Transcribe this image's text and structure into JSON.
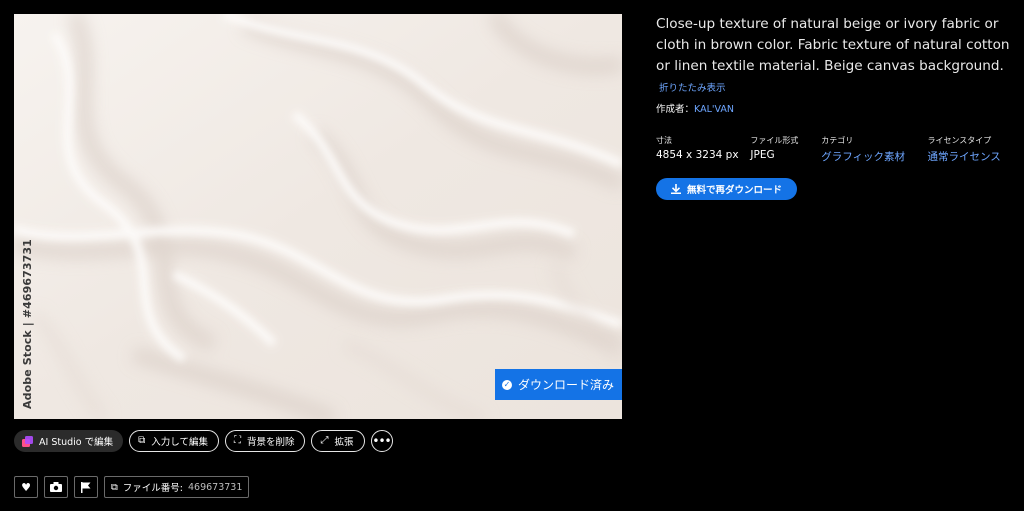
{
  "preview": {
    "watermark": "Adobe Stock | #469673731",
    "downloaded_label": "ダウンロード済み"
  },
  "actions": {
    "ai_studio": "AI Studio で編集",
    "input_edit": "入力して編集",
    "remove_bg": "背景を削除",
    "expand": "拡張",
    "more": "•••"
  },
  "utility": {
    "file_number_label": "ファイル番号:",
    "file_number": "469673731"
  },
  "info": {
    "title": "Close-up texture of natural beige or ivory fabric or cloth in brown color. Fabric texture of natural cotton or linen textile material. Beige canvas background.",
    "toggle": "折りたたみ表示",
    "creator_label": "作成者：",
    "creator_name": "KAL'VAN",
    "meta": {
      "size_label": "寸法",
      "size_value": "4854 x 3234 px",
      "format_label": "ファイル形式",
      "format_value": "JPEG",
      "category_label": "カテゴリ",
      "category_value": "グラフィック素材",
      "license_label": "ライセンスタイプ",
      "license_value": "通常ライセンス"
    },
    "download_button": "無料で再ダウンロード"
  },
  "colors": {
    "accent": "#1473e6",
    "link": "#6ea6ff",
    "background": "#000000"
  }
}
